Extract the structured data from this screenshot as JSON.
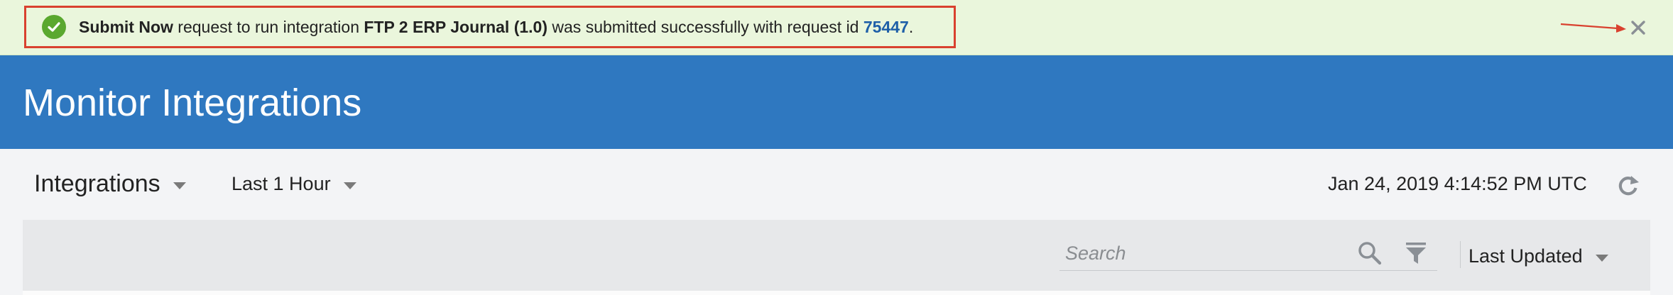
{
  "banner": {
    "action": "Submit Now",
    "text_1": " request to run integration ",
    "integration": "FTP 2 ERP Journal (1.0)",
    "text_2": " was submitted successfully with request id ",
    "request_id": "75447",
    "text_3": ".",
    "success_color": "#5aa82f",
    "highlight_border_color": "#d9412f",
    "icons": {
      "status": "check-circle-icon",
      "close": "close-icon",
      "annotation": "arrow-icon"
    }
  },
  "header": {
    "title": "Monitor Integrations",
    "color": "#2f78c0"
  },
  "toolbar": {
    "view_label": "Integrations",
    "range_label": "Last 1 Hour",
    "timestamp": "Jan 24, 2019 4:14:52 PM UTC",
    "refresh_icon": "refresh-icon"
  },
  "filters": {
    "search_placeholder": "Search",
    "search_value": "",
    "search_icon": "search-icon",
    "filter_icon": "filter-icon",
    "sort_label": "Last Updated"
  }
}
